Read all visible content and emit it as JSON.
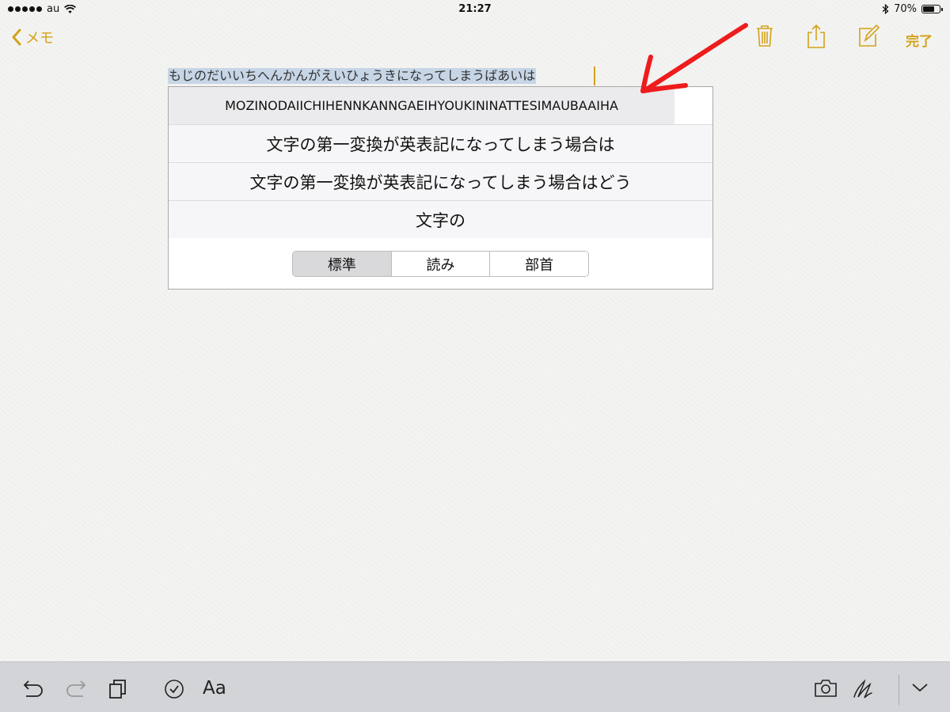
{
  "status_bar": {
    "carrier": "au",
    "time": "21:27",
    "battery": "70%",
    "battery_level": 0.7,
    "icons": [
      "signal-dots-icon",
      "wifi-icon",
      "bluetooth-icon",
      "battery-icon"
    ]
  },
  "nav": {
    "back_label": "メモ",
    "done_label": "完了",
    "tools": [
      "trash-icon",
      "share-icon",
      "compose-icon"
    ]
  },
  "note": {
    "text": "もじのだいいちへんかんがえいひょうきになってしまうばあいは"
  },
  "candidates": [
    "MOZINODAIICHIHENNKANNGAEIHYOUKININATTESIMAUBAAIHA",
    "文字の第一変換が英表記になってしまう場合は",
    "文字の第一変換が英表記になってしまう場合はどう",
    "文字の"
  ],
  "segments": {
    "items": [
      "標準",
      "読み",
      "部首"
    ],
    "selected": "標準"
  },
  "toolbar": {
    "format_label": "Aa",
    "icons": [
      "undo-icon",
      "redo-icon",
      "copy-icon",
      "checklist-icon",
      "camera-icon",
      "sketch-icon",
      "dismiss-keyboard-icon"
    ]
  },
  "colors": {
    "accent": "#d4a21a",
    "annotation": "#ee1c1c",
    "selection": "#c6d6e6"
  }
}
